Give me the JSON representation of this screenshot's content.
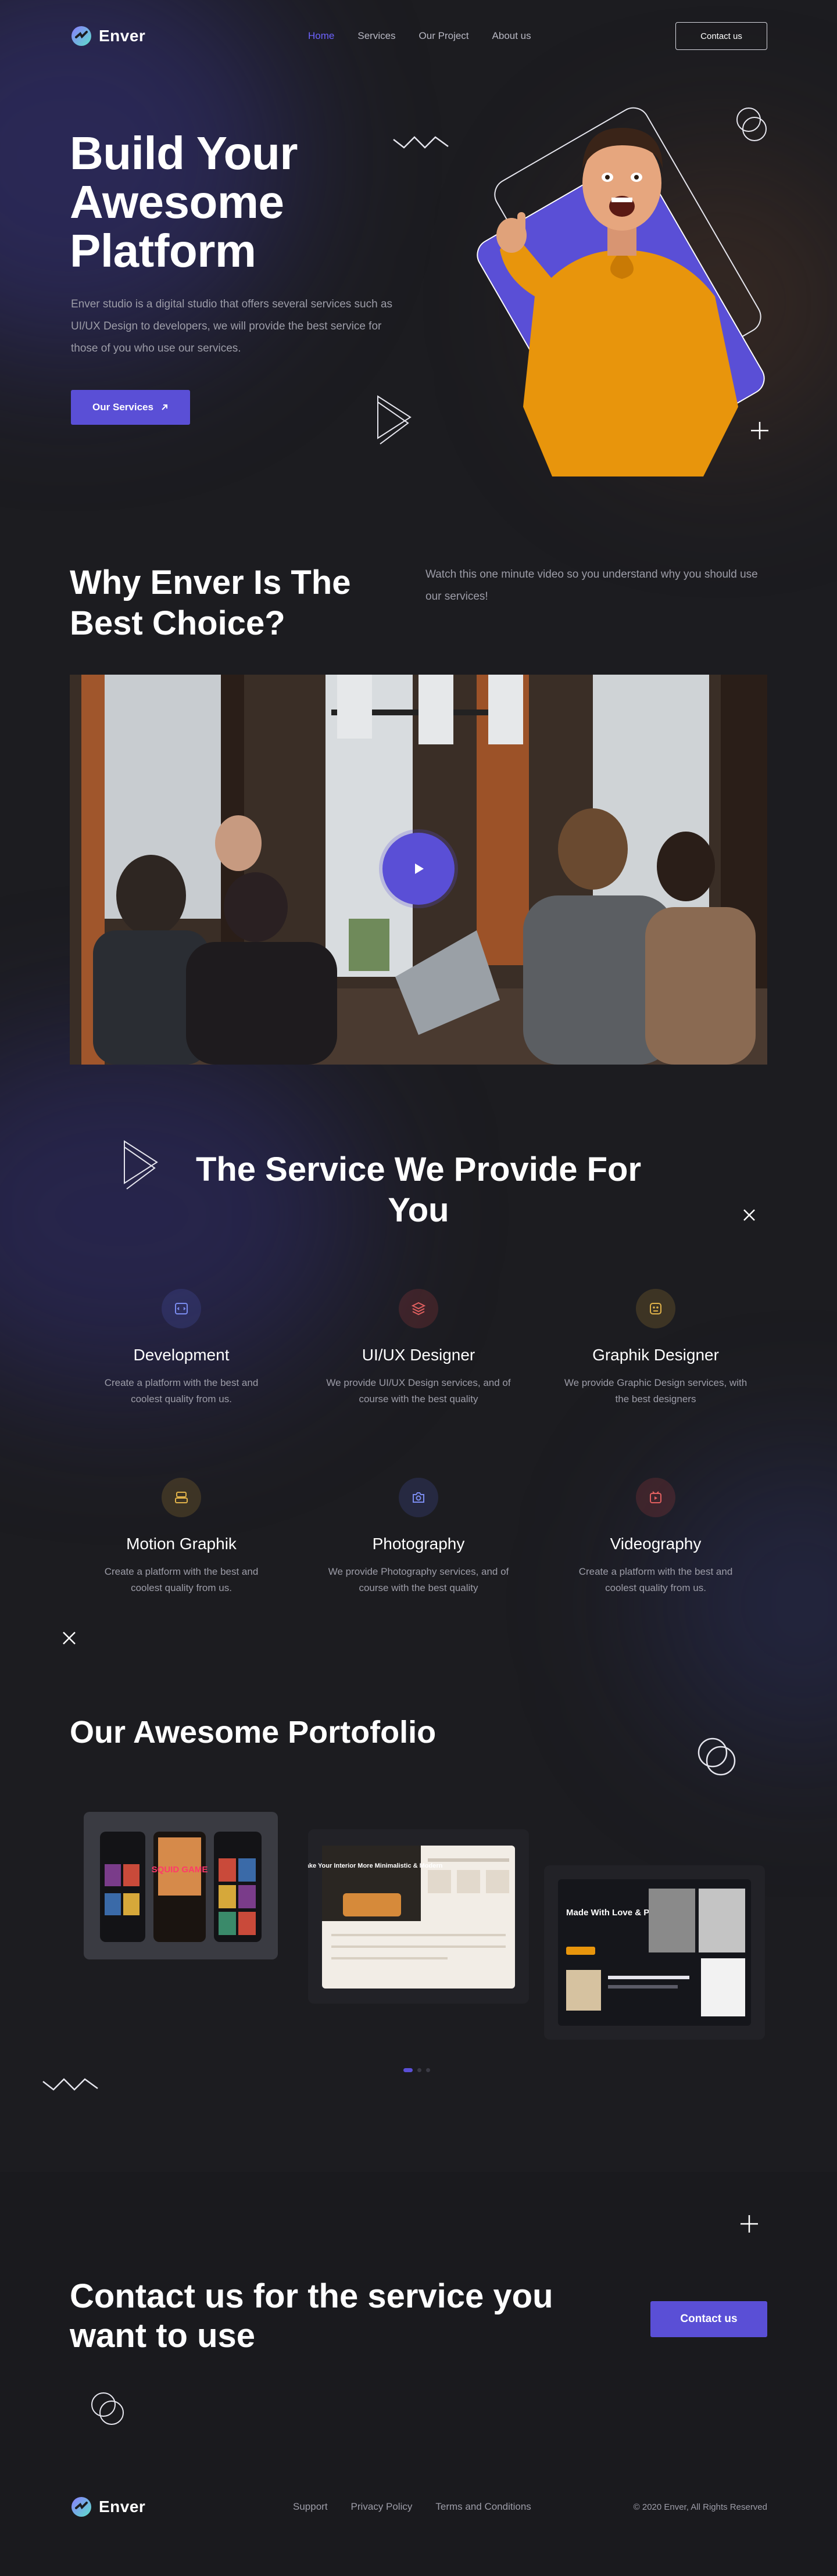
{
  "brand": {
    "name": "Enver"
  },
  "nav": {
    "items": [
      {
        "label": "Home",
        "active": true
      },
      {
        "label": "Services",
        "active": false
      },
      {
        "label": "Our Project",
        "active": false
      },
      {
        "label": "About us",
        "active": false
      }
    ],
    "contact_label": "Contact us"
  },
  "hero": {
    "title": "Build Your Awesome Platform",
    "description": "Enver studio is a digital studio that offers several services such as UI/UX Design to developers, we will provide the best service for those of you who use our services.",
    "cta_label": "Our Services"
  },
  "why": {
    "title": "Why Enver Is The Best Choice?",
    "description": "Watch this one minute video so you understand why you should use our services!"
  },
  "services": {
    "title": "The Service We Provide For You",
    "items": [
      {
        "name": "Development",
        "description": "Create a platform with the best and coolest quality from us.",
        "icon": "code-icon",
        "color": "#5a6cd6"
      },
      {
        "name": "UI/UX Designer",
        "description": "We provide UI/UX Design services, and of course with the best quality",
        "icon": "layers-icon",
        "color": "#d64a4a"
      },
      {
        "name": "Graphik Designer",
        "description": "We provide Graphic Design services, with the best designers",
        "icon": "palette-icon",
        "color": "#d6a83a"
      },
      {
        "name": "Motion Graphik",
        "description": "Create a platform with the best and coolest quality from us.",
        "icon": "motion-icon",
        "color": "#d6a83a"
      },
      {
        "name": "Photography",
        "description": "We provide Photography services, and of course with the best quality",
        "icon": "camera-icon",
        "color": "#5a6cd6"
      },
      {
        "name": "Videography",
        "description": "Create a platform with the best and coolest quality from us.",
        "icon": "video-icon",
        "color": "#d64a4a"
      }
    ]
  },
  "portfolio": {
    "title": "Our Awesome Portofolio",
    "slide_count": 3,
    "active_slide": 1,
    "card2_headline": "Make Your Interior More Minimalistic & Modern",
    "card3_headline": "Made With Love & Purpose",
    "card1_badge": "SQUID GAME"
  },
  "contact": {
    "title": "Contact us for the service you want to use",
    "cta_label": "Contact us"
  },
  "footer": {
    "links": [
      "Support",
      "Privacy Policy",
      "Terms and Conditions"
    ],
    "copyright": "© 2020 Enver, All Rights Reserved"
  },
  "colors": {
    "accent": "#5a4fd6",
    "nav_active": "#6d63ff",
    "background": "#1c1c20"
  }
}
